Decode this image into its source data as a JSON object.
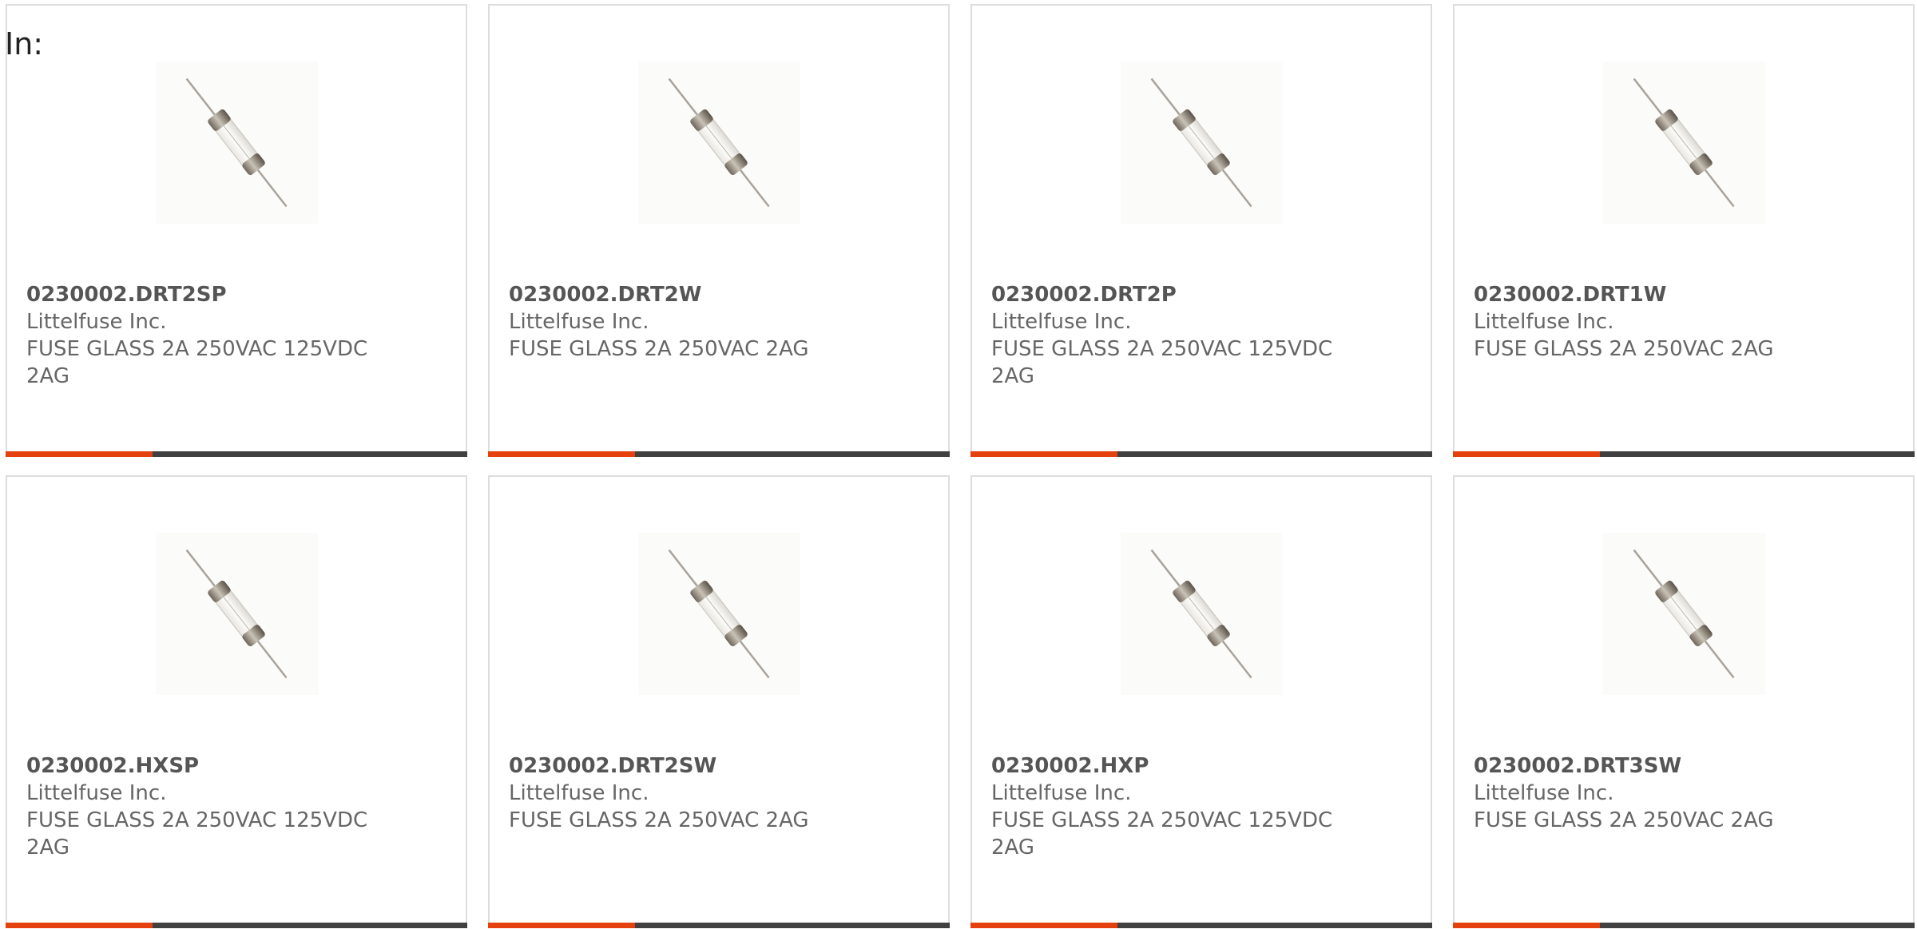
{
  "page": {
    "in_label": "In:"
  },
  "colors": {
    "accent": "#e5410f",
    "bar": "#404040",
    "border": "#dddddd",
    "text": "#555555"
  },
  "products": [
    {
      "part_number": "0230002.DRT2SP",
      "manufacturer": "Littelfuse Inc.",
      "description": "FUSE GLASS 2A 250VAC 125VDC 2AG",
      "image_icon": "glass-fuse-icon"
    },
    {
      "part_number": "0230002.DRT2W",
      "manufacturer": "Littelfuse Inc.",
      "description": "FUSE GLASS 2A 250VAC 2AG",
      "image_icon": "glass-fuse-icon"
    },
    {
      "part_number": "0230002.DRT2P",
      "manufacturer": "Littelfuse Inc.",
      "description": "FUSE GLASS 2A 250VAC 125VDC 2AG",
      "image_icon": "glass-fuse-icon"
    },
    {
      "part_number": "0230002.DRT1W",
      "manufacturer": "Littelfuse Inc.",
      "description": "FUSE GLASS 2A 250VAC 2AG",
      "image_icon": "glass-fuse-icon"
    },
    {
      "part_number": "0230002.HXSP",
      "manufacturer": "Littelfuse Inc.",
      "description": "FUSE GLASS 2A 250VAC 125VDC 2AG",
      "image_icon": "glass-fuse-icon"
    },
    {
      "part_number": "0230002.DRT2SW",
      "manufacturer": "Littelfuse Inc.",
      "description": "FUSE GLASS 2A 250VAC 2AG",
      "image_icon": "glass-fuse-icon"
    },
    {
      "part_number": "0230002.HXP",
      "manufacturer": "Littelfuse Inc.",
      "description": "FUSE GLASS 2A 250VAC 125VDC 2AG",
      "image_icon": "glass-fuse-icon"
    },
    {
      "part_number": "0230002.DRT3SW",
      "manufacturer": "Littelfuse Inc.",
      "description": "FUSE GLASS 2A 250VAC 2AG",
      "image_icon": "glass-fuse-icon"
    }
  ]
}
